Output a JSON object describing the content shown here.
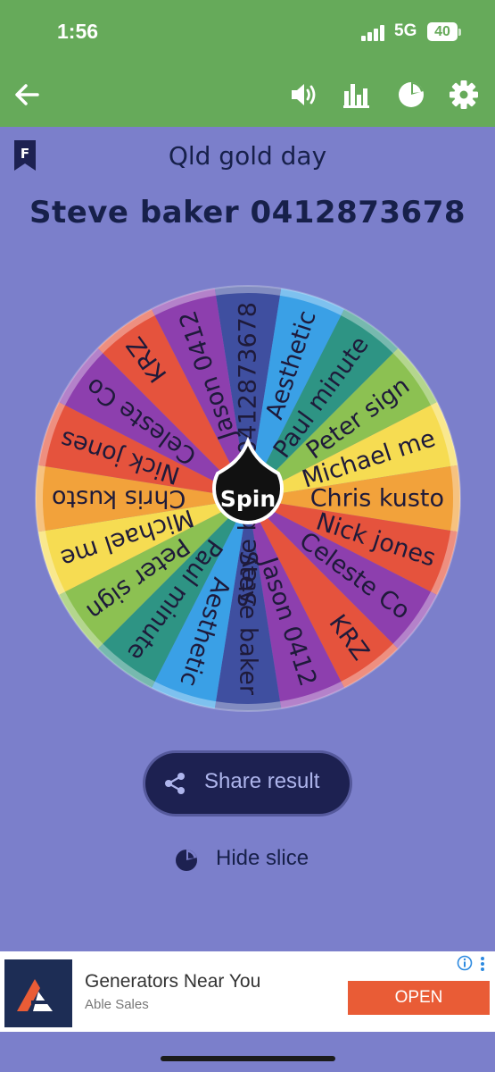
{
  "status_bar": {
    "time": "1:56",
    "network": "5G",
    "battery": "40"
  },
  "app_bar": {
    "icons": [
      "back-arrow-icon",
      "volume-icon",
      "bar-chart-icon",
      "pie-chart-icon",
      "settings-gear-icon"
    ]
  },
  "badge": "F",
  "wheel": {
    "title": "Qld gold day",
    "result": "Steve baker 0412873678",
    "spin_label": "Spin",
    "slices": [
      {
        "label": "Steve baker 0412873678",
        "color": "#3f4fa0"
      },
      {
        "label": "Aesthetic",
        "color": "#3aa0e6"
      },
      {
        "label": "Paul minute",
        "color": "#2e9484"
      },
      {
        "label": "Peter sign",
        "color": "#8cc152"
      },
      {
        "label": "Michael me",
        "color": "#f6dc52"
      },
      {
        "label": "Chris kusto",
        "color": "#f2a23b"
      },
      {
        "label": "Nick jones",
        "color": "#e5533d"
      },
      {
        "label": "Celeste Co",
        "color": "#8d3fae"
      },
      {
        "label": "KRZ",
        "color": "#e5533d"
      },
      {
        "label": "Jason 0412",
        "color": "#8d3fae"
      },
      {
        "label": "Steve baker",
        "color": "#3f4fa0"
      },
      {
        "label": "Aesthetic",
        "color": "#3aa0e6"
      },
      {
        "label": "Paul minute",
        "color": "#2e9484"
      },
      {
        "label": "Peter sign",
        "color": "#8cc152"
      },
      {
        "label": "Michael me",
        "color": "#f6dc52"
      },
      {
        "label": "Chris kusto",
        "color": "#f2a23b"
      },
      {
        "label": "Nick jones",
        "color": "#e5533d"
      },
      {
        "label": "Celeste Co",
        "color": "#8d3fae"
      },
      {
        "label": "KRZ",
        "color": "#e5533d"
      },
      {
        "label": "Jason 0412",
        "color": "#8d3fae"
      }
    ]
  },
  "actions": {
    "share_label": "Share result",
    "hide_slice_label": "Hide slice"
  },
  "ad": {
    "title": "Generators Near You",
    "subtitle": "Able Sales",
    "button": "OPEN"
  },
  "colors": {
    "app_bar": "#66aa5a",
    "background": "#7b7fcb",
    "dark_text": "#17204a",
    "share_button": "#1d2151",
    "ad_button": "#e95c36"
  }
}
